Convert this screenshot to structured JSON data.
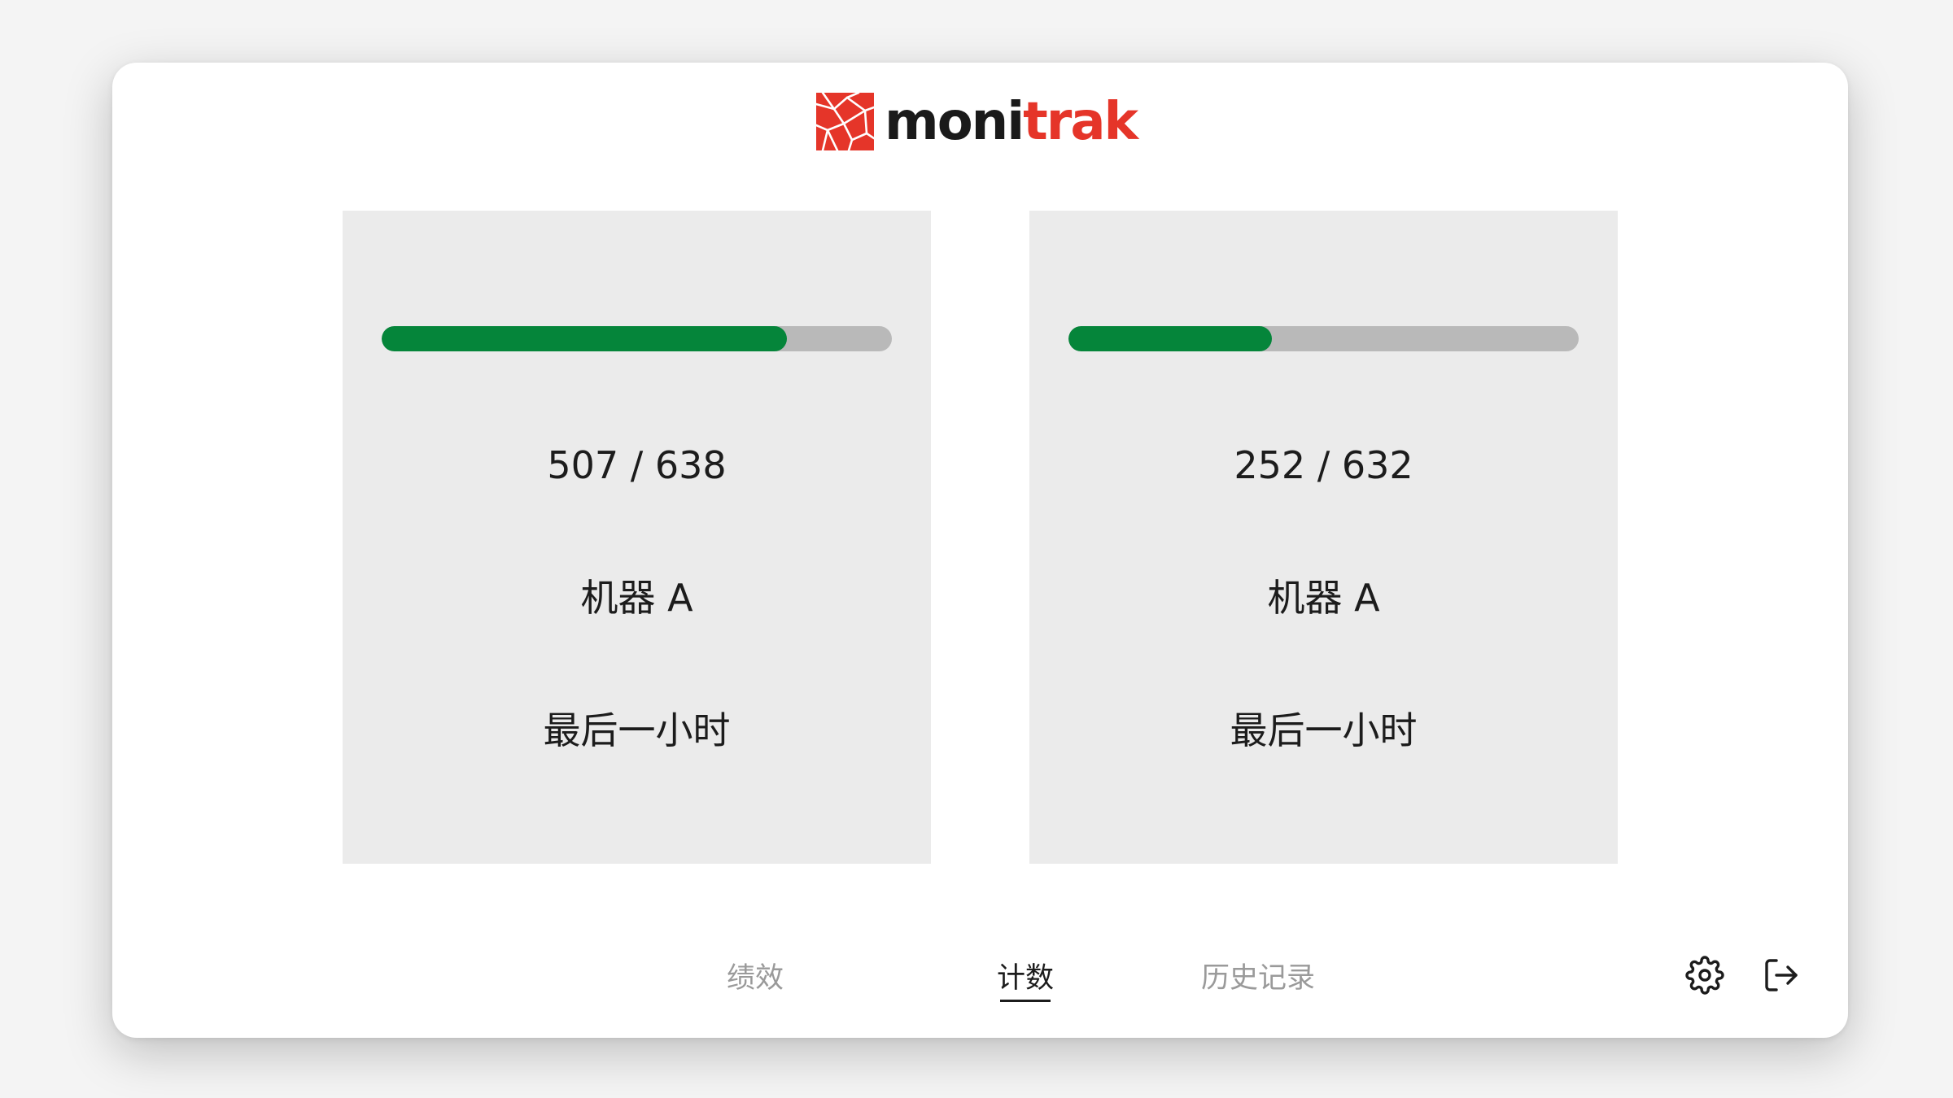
{
  "brand": {
    "part1": "moni",
    "part2": "trak",
    "colors": {
      "dark": "#1a1a1a",
      "red": "#e53529"
    }
  },
  "cards": [
    {
      "progress_fraction": 0.7947,
      "count": "507 / 638",
      "machine": "机器 A",
      "period": "最后一小时"
    },
    {
      "progress_fraction": 0.3987,
      "count": "252 / 632",
      "machine": "机器 A",
      "period": "最后一小时"
    }
  ],
  "colors": {
    "progress_fill": "#05853a",
    "progress_track": "#b9b9b9",
    "card_bg": "#ebebeb"
  },
  "nav": {
    "performance": "绩效",
    "count": "计数",
    "history": "历史记录",
    "active": "count"
  },
  "icons": {
    "settings": "gear-icon",
    "logout": "logout-icon"
  }
}
